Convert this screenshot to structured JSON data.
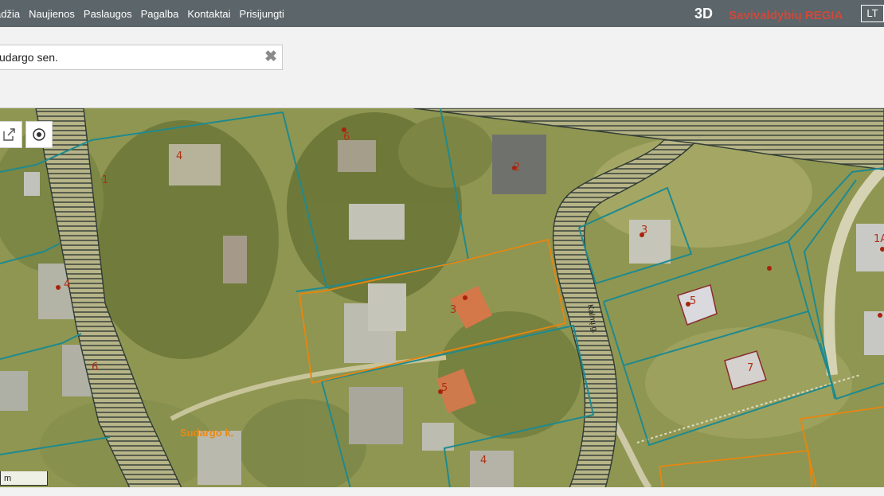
{
  "nav": {
    "items": [
      {
        "label": "adžia"
      },
      {
        "label": "Naujienos"
      },
      {
        "label": "Paslaugos"
      },
      {
        "label": "Pagalba"
      },
      {
        "label": "Kontaktai"
      },
      {
        "label": "Prisijungti"
      }
    ]
  },
  "header": {
    "mode_3d": "3D",
    "brand": "Savivaldybių REGIA",
    "language": "LT"
  },
  "search": {
    "value": "udargo sen."
  },
  "map": {
    "place_label": "Sudargo k.",
    "street_label": "Kalnų g.",
    "plot_labels": [
      "1",
      "4",
      "6",
      "2",
      "3",
      "4",
      "3",
      "5",
      "6",
      "5",
      "7",
      "1A",
      "4"
    ],
    "scale_label": "m",
    "colors": {
      "parcel_border": "#1f8a8e",
      "selected_parcel": "#e8860f",
      "road_hatch": "#2f3a34",
      "point_marker": "#a8230c"
    }
  },
  "tools": {
    "share_icon": "share-icon",
    "locate_icon": "locate-icon"
  }
}
